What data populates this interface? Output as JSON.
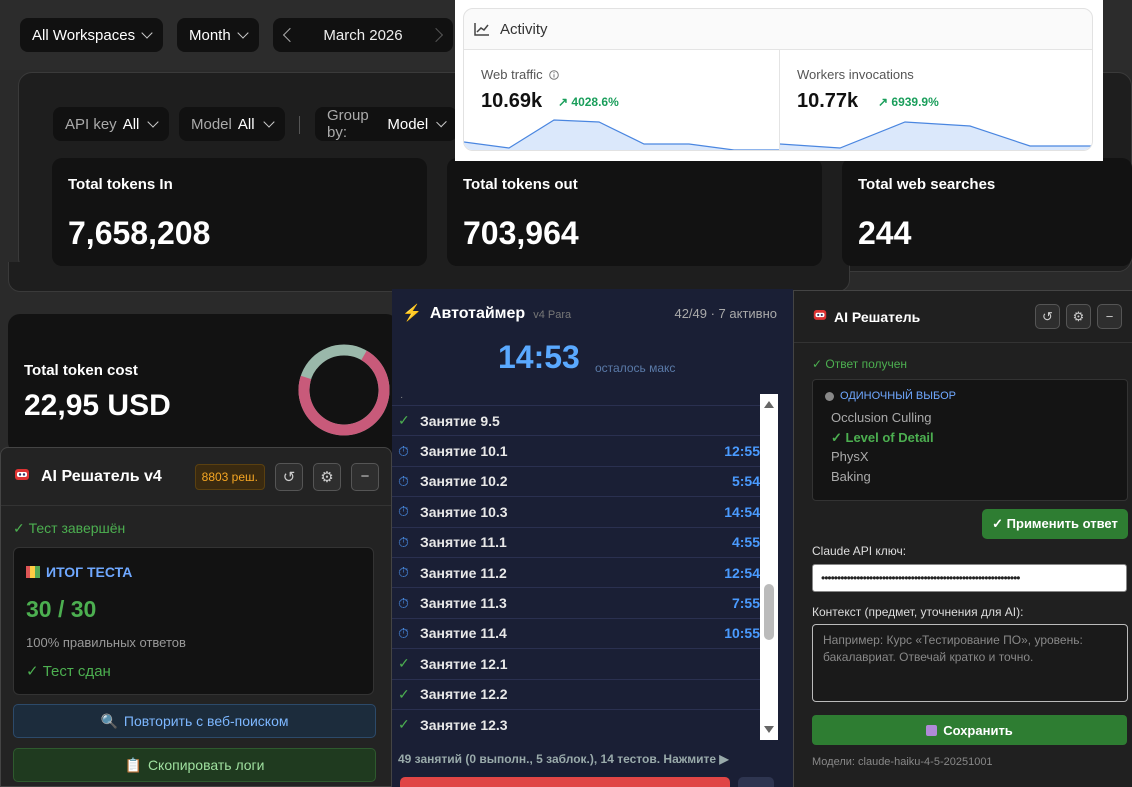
{
  "dashboard": {
    "filters": {
      "workspace": "All Workspaces",
      "period": "Month",
      "date": "March 2026"
    },
    "subfilters": {
      "api_key_label": "API key",
      "api_key_value": "All",
      "model_label": "Model",
      "model_value": "All",
      "group_label": "Group by:",
      "group_value": "Model"
    },
    "kpis": [
      {
        "title": "Total tokens In",
        "value": "7,658,208"
      },
      {
        "title": "Total tokens out",
        "value": "703,964"
      },
      {
        "title": "Total web searches",
        "value": "244"
      }
    ],
    "cost": {
      "title": "Total token cost",
      "value": "22,95 USD"
    },
    "colors": {
      "donut_main": "#c85a7a",
      "donut_secondary": "#9ab8aa"
    }
  },
  "activity": {
    "title": "Activity",
    "cells": [
      {
        "label": "Web traffic",
        "value": "10.69k",
        "change": "4028.6%"
      },
      {
        "label": "Workers invocations",
        "value": "10.77k",
        "change": "6939.9%"
      }
    ]
  },
  "solver_v4": {
    "title": "AI Решатель v4",
    "badge": "8803 реш.",
    "status": "✓ Тест завершён",
    "result_heading": "ИТОГ ТЕСТА",
    "score": "30 / 30",
    "subtitle": "100% правильных ответов",
    "passed": "✓ Тест сдан",
    "retry_label": "Повторить с веб-поиском",
    "copy_label": "Скопировать логи"
  },
  "timer": {
    "title": "Автотаймер",
    "version": "v4 Para",
    "counter": "42/49 · 7 активно",
    "clock": "14:53",
    "clock_sub": "осталось макс",
    "items": [
      {
        "status": "done",
        "name": "Занятие 9.5",
        "time": ""
      },
      {
        "status": "clock",
        "name": "Занятие 10.1",
        "time": "12:55"
      },
      {
        "status": "clock",
        "name": "Занятие 10.2",
        "time": "5:54"
      },
      {
        "status": "clock",
        "name": "Занятие 10.3",
        "time": "14:54"
      },
      {
        "status": "clock",
        "name": "Занятие 11.1",
        "time": "4:55"
      },
      {
        "status": "clock",
        "name": "Занятие 11.2",
        "time": "12:54"
      },
      {
        "status": "clock",
        "name": "Занятие 11.3",
        "time": "7:55"
      },
      {
        "status": "clock",
        "name": "Занятие 11.4",
        "time": "10:55"
      },
      {
        "status": "done",
        "name": "Занятие 12.1",
        "time": ""
      },
      {
        "status": "done",
        "name": "Занятие 12.2",
        "time": ""
      },
      {
        "status": "done",
        "name": "Занятие 12.3",
        "time": ""
      }
    ],
    "footer": "49 занятий (0 выполн., 5 заблок.), 14 тестов. Нажмите ▶"
  },
  "solver": {
    "title": "AI Решатель",
    "status": "✓ Ответ получен",
    "kind": "ОДИНОЧНЫЙ ВЫБОР",
    "options": [
      {
        "text": "Occlusion Culling",
        "selected": false
      },
      {
        "text": "✓ Level of Detail",
        "selected": true
      },
      {
        "text": "PhysX",
        "selected": false
      },
      {
        "text": "Baking",
        "selected": false
      }
    ],
    "apply_label": "✓ Применить ответ",
    "key_label": "Claude API ключ:",
    "key_value": "••••••••••••••••••••••••••••••••••••••••••••••••••••••••••••••",
    "context_label": "Контекст (предмет, уточнения для AI):",
    "context_placeholder": "Например: Курс «Тестирование ПО», уровень: бакалавриат. Отвечай кратко и точно.",
    "save_label": "Сохранить",
    "models": "Модели: claude-haiku-4-5-20251001"
  }
}
